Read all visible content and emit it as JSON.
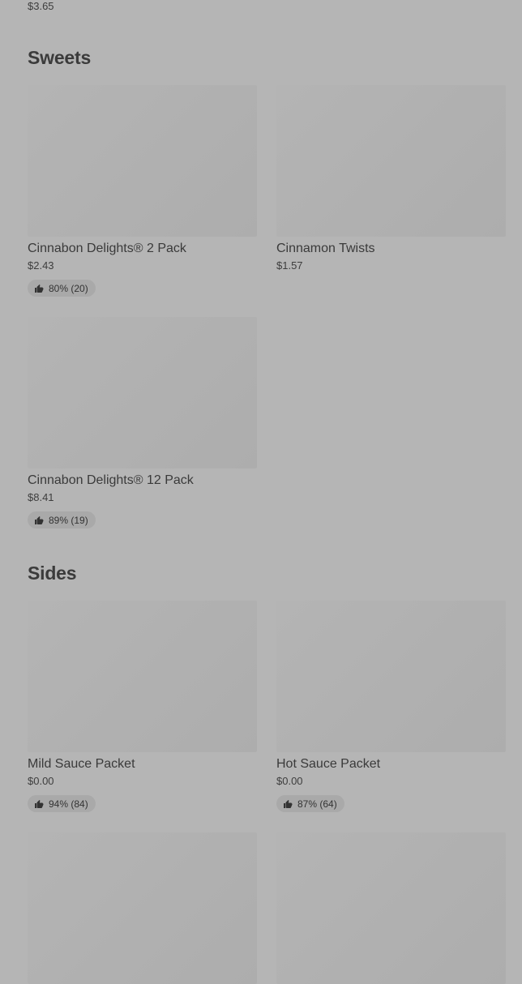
{
  "top_item": {
    "price": "$3.65"
  },
  "sections": [
    {
      "title": "Sweets",
      "items": [
        {
          "name": "Cinnabon Delights® 2 Pack",
          "price": "$2.43",
          "rating": "80% (20)"
        },
        {
          "name": "Cinnamon Twists",
          "price": "$1.57"
        },
        {
          "name": "Cinnabon Delights® 12 Pack",
          "price": "$8.41",
          "rating": "89% (19)"
        }
      ]
    },
    {
      "title": "Sides",
      "items": [
        {
          "name": "Mild Sauce Packet",
          "price": "$0.00",
          "rating": "94% (84)"
        },
        {
          "name": "Hot Sauce Packet",
          "price": "$0.00",
          "rating": "87% (64)"
        }
      ]
    }
  ],
  "icons": {
    "rating": "thumbs-up-icon"
  }
}
